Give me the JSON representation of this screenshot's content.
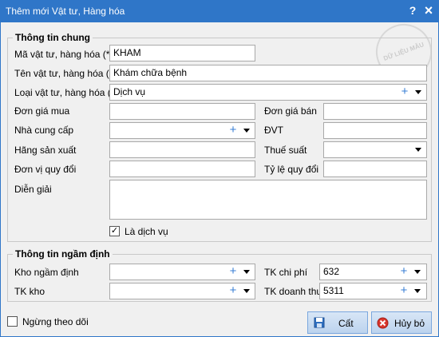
{
  "window": {
    "title": "Thêm mới Vật tư, Hàng hóa",
    "help_glyph": "?",
    "close_glyph": "×"
  },
  "stamp_text": "DỮ LIỆU MẪU",
  "general": {
    "title": "Thông tin chung",
    "code_label": "Mã vật tư, hàng hóa (*)",
    "code_value": "KHAM",
    "name_label": "Tên vật tư, hàng hóa (*)",
    "name_value": "Khám chữa bệnh",
    "type_label": "Loại vật tư, hàng hóa (*)",
    "type_value": "Dịch vụ",
    "buy_price_label": "Đơn giá mua",
    "buy_price_value": "",
    "sell_price_label": "Đơn giá bán",
    "sell_price_value": "",
    "supplier_label": "Nhà cung cấp",
    "supplier_value": "",
    "unit_label": "ĐVT",
    "unit_value": "",
    "manufacturer_label": "Hãng sản xuất",
    "manufacturer_value": "",
    "tax_label": "Thuế suất",
    "tax_value": "",
    "conv_unit_label": "Đơn vị quy đổi",
    "conv_unit_value": "",
    "conv_rate_label": "Tỷ lệ quy đổi",
    "conv_rate_value": "",
    "desc_label": "Diễn giải",
    "desc_value": "",
    "is_service_label": "Là dịch vụ",
    "is_service_checked": true
  },
  "defaults": {
    "title": "Thông tin ngầm định",
    "warehouse_label": "Kho ngầm định",
    "warehouse_value": "",
    "expense_acc_label": "TK chi phí",
    "expense_acc_value": "632",
    "stock_acc_label": "TK kho",
    "stock_acc_value": "",
    "revenue_acc_label": "TK doanh thu",
    "revenue_acc_value": "5311"
  },
  "footer": {
    "stop_tracking_label": "Ngừng theo dõi",
    "stop_tracking_checked": false,
    "save_label": "Cất",
    "cancel_label": "Hủy bỏ"
  },
  "glyphs": {
    "plus": "+",
    "check": "✓"
  },
  "colors": {
    "title_bar": "#2f76c8",
    "accent_plus": "#3a7fd5"
  }
}
